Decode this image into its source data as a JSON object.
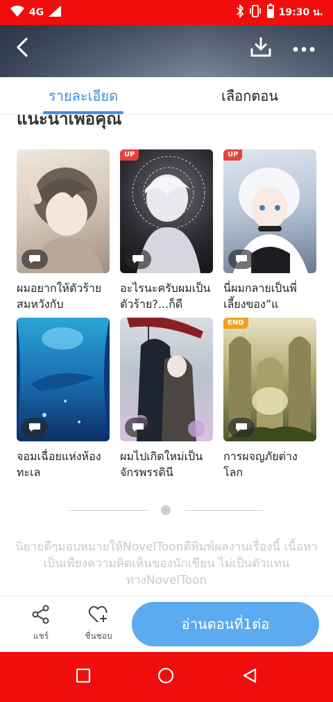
{
  "status_bar": {
    "network": "4G",
    "time": "19:30 น.",
    "icons": [
      "wifi-icon",
      "signal-icon",
      "bluetooth-icon",
      "vibrate-icon",
      "battery-icon"
    ]
  },
  "header": {
    "back_icon": "chevron-left-icon",
    "download_icon": "download-icon",
    "more_icon": "more-dots-icon"
  },
  "tabs": [
    {
      "label": "รายละเอียด",
      "active": true
    },
    {
      "label": "เลือกตอน",
      "active": false
    }
  ],
  "section": {
    "title": "แนะนำเพื่อคุณ"
  },
  "recommendations": [
    {
      "title": "ผมอยากให้ตัวร้ายสมหวังกับ",
      "badge": ""
    },
    {
      "title": "อะไรนะครับผมเป็นตัวร้าย?...ก็ดี",
      "badge": "UP"
    },
    {
      "title": "นี่ผมกลายเป็นพี่เลี้ยงของ”แ",
      "badge": "UP"
    },
    {
      "title": "จอมเฉื่อยแห่งห้องทะเล",
      "badge": ""
    },
    {
      "title": "ผมไปเกิดใหม่เป็นจักรพรรดินี",
      "badge": ""
    },
    {
      "title": "การผจญภัยต่างโลก",
      "badge": "END"
    }
  ],
  "disclaimer": "นิยายดีๆมอบหมายให้NovelToonตีพิมพ์ผลงานเรื่องนี้ เนื้อหาเป็นเพียงความคิดเห็นของนักเขียน ไม่เป็นตัวแทนทางNovelToon",
  "action_bar": {
    "share_label": "แชร์",
    "like_label": "ชื่นชอบ",
    "read_label": "อ่านตอนที่1ต่อ"
  },
  "colors": {
    "system_bar": "#f20d0d",
    "accent": "#3a8ee6",
    "read_button": "#5caaf0",
    "badge_up": "#e8433a",
    "badge_end": "#f0a11e"
  }
}
